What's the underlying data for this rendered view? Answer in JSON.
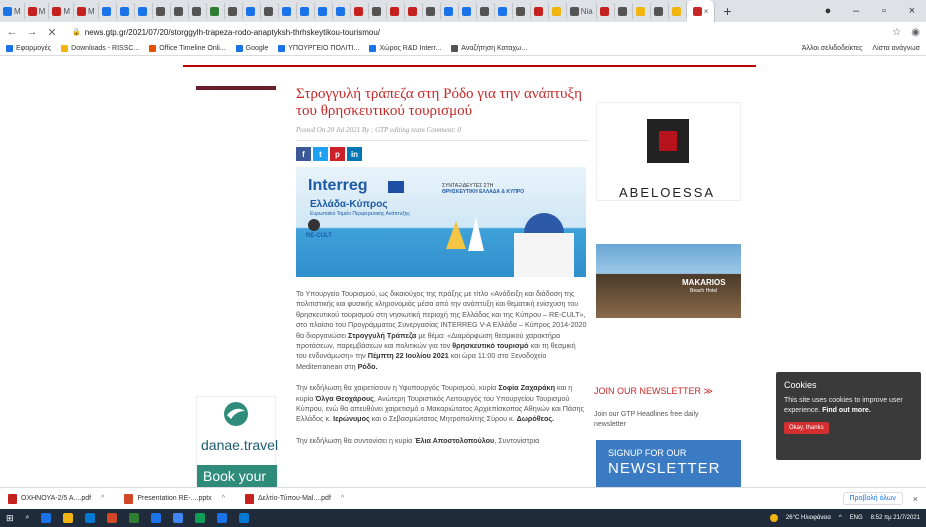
{
  "browser": {
    "tabs_small": [
      {
        "label": "M",
        "color": "#1a73e8"
      },
      {
        "label": "M",
        "color": "#c5221f"
      },
      {
        "label": "M",
        "color": "#c5221f"
      },
      {
        "label": "M",
        "color": "#c5221f"
      },
      {
        "label": "",
        "color": "#1a73e8"
      },
      {
        "label": "",
        "color": "#1a73e8"
      },
      {
        "label": "",
        "color": "#1a73e8"
      },
      {
        "label": "",
        "color": "#555"
      },
      {
        "label": "",
        "color": "#555"
      },
      {
        "label": "",
        "color": "#555"
      },
      {
        "label": "",
        "color": "#2e7d32"
      },
      {
        "label": "",
        "color": "#555"
      },
      {
        "label": "",
        "color": "#1a73e8"
      },
      {
        "label": "",
        "color": "#555"
      },
      {
        "label": "",
        "color": "#1a73e8"
      },
      {
        "label": "",
        "color": "#1a73e8"
      },
      {
        "label": "",
        "color": "#1a73e8"
      },
      {
        "label": "",
        "color": "#1a73e8"
      },
      {
        "label": "",
        "color": "#c5221f"
      },
      {
        "label": "",
        "color": "#555"
      },
      {
        "label": "",
        "color": "#c5221f"
      },
      {
        "label": "",
        "color": "#c5221f"
      },
      {
        "label": "",
        "color": "#555"
      },
      {
        "label": "",
        "color": "#1a73e8"
      },
      {
        "label": "",
        "color": "#1a73e8"
      },
      {
        "label": "",
        "color": "#555"
      },
      {
        "label": "",
        "color": "#1a73e8"
      },
      {
        "label": "",
        "color": "#555"
      },
      {
        "label": "",
        "color": "#c5221f"
      },
      {
        "label": "",
        "color": "#f2b40f"
      },
      {
        "label": "Nia",
        "color": "#555"
      },
      {
        "label": "",
        "color": "#c5221f"
      },
      {
        "label": "",
        "color": "#555"
      },
      {
        "label": "",
        "color": "#f2b40f"
      },
      {
        "label": "",
        "color": "#555"
      },
      {
        "label": "",
        "color": "#f2b40f"
      }
    ],
    "active_tab_close": "×",
    "new_tab": "+",
    "window_controls": {
      "minimize": "–",
      "maximize": "▫",
      "close": "×"
    },
    "url": "news.gtp.gr/2021/07/20/storggylh-trapeza-rodo-anaptyksh-thrhskeytikou-tourismou/",
    "back": "←",
    "forward": "→",
    "reload": "✕",
    "star": "☆",
    "bookmarks": [
      {
        "label": "Εφαρμογές",
        "color": "#1a73e8"
      },
      {
        "label": "Downloads - RISSC...",
        "color": "#f2b40f"
      },
      {
        "label": "Office Timeline Onli...",
        "color": "#e65100"
      },
      {
        "label": "Google",
        "color": "#1a73e8"
      },
      {
        "label": "ΥΠΟΥΡΓΕΙΟ ΠΟΛΙΤΙ...",
        "color": "#1a73e8"
      },
      {
        "label": "Χώρος R&D Interr...",
        "color": "#1a73e8"
      },
      {
        "label": "Αναζήτηση Καταχω...",
        "color": "#555"
      }
    ],
    "bookmarks_right": [
      "Άλλοι σελιδοδείκτες",
      "Λίστα ανάγνωσ"
    ]
  },
  "article": {
    "title": "Στρογγυλή τράπεζα στη Ρόδο για την ανάπτυξη του θρησκευτικού τουρισμού",
    "meta": "Posted On 20 Jul 2021   By : GTP editing team   Comment: 0",
    "share": [
      "f",
      "t",
      "p",
      "in"
    ],
    "hero": {
      "logo": "Interreg",
      "program": "Ελλάδα-Κύπρος",
      "program_sub": "Ευρωπαϊκό Ταμείο Περιφερειακής Ανάπτυξης",
      "tagline_top": "ΣΥΝΤΑΞΙΔΕΥΤΕΣ ΣΤΗ",
      "tagline": "ΘΡΗΣΚΕΥΤΙΚΗ ΕΛΛΑΔΑ & ΚΥΠΡΟ",
      "recult": "RE-CULT"
    },
    "p1": "Το Υπουργείο Τουρισμού, ως δικαιούχος της πράξης με τίτλο «Ανάδειξη και διάδοση της πολιτιστικής και φυσικής κληρονομιάς μέσα από την ανάπτυξη και θεματική ενίσχυση του θρησκευτικού τουρισμού στη νησιωτική περιοχή της Ελλάδας και της Κύπρου – RE-CULT», στο πλαίσιο του Προγράμματος Συνεργασίας INTERREG V-A Ελλάδα – Κύπρος 2014-2020 θα διοργανώσει",
    "p1_b1": "Στρογγυλή Τράπεζα",
    "p1_b": " με θέμα: «Διαμόρφωση θεσμικού χαρακτήρα προτάσεων, παρεμβάσεων και πολιτικών για τον ",
    "p1_b2": "θρησκευτικό τουρισμό",
    "p1_c": " και τη θεσμική του ενδυνάμωση» την ",
    "p1_b3": "Πέμπτη 22 Ιουλίου 2021",
    "p1_d": " και ώρα 11:00 στο Ξενοδοχείο Mediterranean στη ",
    "p1_b4": "Ρόδο.",
    "p2_a": "Την εκδήλωση θα χαιρετίσουν η Υφυπουργός Τουρισμού, κυρία ",
    "p2_b1": "Σοφία Ζαχαράκη",
    "p2_b": " και η κυρία ",
    "p2_b2": "Όλγα Θεοχάρους",
    "p2_c": ", Ανώτερη Τουριστικός Λειτουργός του Υπουργείου Τουρισμού Κύπρου, ενώ θα απευθύνει χαιρετισμό ο Μακαριώτατος Αρχιεπίσκοπος Αθηνών και Πάσης Ελλάδος κ. ",
    "p2_b3": "Ιερώνυμος",
    "p2_d": " και ο Σεβασμιώτατος Μητροπολίτης Σύρου κ. ",
    "p2_b4": "Δωρόθεος.",
    "p3_a": "Την εκδήλωση θα συντονίσει η κυρία ",
    "p3_b1": "Έλια Αποστολοπούλου",
    "p3_b": ", Συντονίστρια"
  },
  "sidebar": {
    "ad1": "ABELOESSA",
    "ad2_name": "MAKARIOS",
    "ad2_sub": "Beach Hotel",
    "newsletter_title": "JOIN OUR NEWSLETTER",
    "newsletter_arrow": "≫",
    "newsletter_text": "Join our GTP Headlines free daily newsletter",
    "newsletter_btn_a": "SIGNUP FOR OUR",
    "newsletter_btn_b": "NEWSLETTER"
  },
  "left_ad": {
    "brand": "danae.travel",
    "cta": "Book your"
  },
  "cookie": {
    "title": "Cookies",
    "text": "This site uses cookies to improve user experience.",
    "link": "Find out more.",
    "button": "Okay, thanks"
  },
  "downloads": {
    "items": [
      {
        "name": "ΟΧΗΝΟΥΑ-2/5 Α....pdf",
        "color": "#c5221f"
      },
      {
        "name": "Presentation RE-....pptx",
        "color": "#d24726"
      },
      {
        "name": "Δελτίο-Τύπου-Mal....pdf",
        "color": "#c5221f"
      }
    ],
    "show_all": "Προβολή όλων",
    "close": "×"
  },
  "taskbar": {
    "apps": [
      "#1a73e8",
      "#f2b40f",
      "#0078d4",
      "#d24726",
      "#2e7d32",
      "#1a73e8",
      "#4285f4",
      "#0f9d58",
      "#1a73e8",
      "#0078d4"
    ],
    "weather": "26°C  Ηλιοφάνεια",
    "lang": "ENG",
    "time": "8:52 πμ",
    "date": "21/7/2021"
  }
}
